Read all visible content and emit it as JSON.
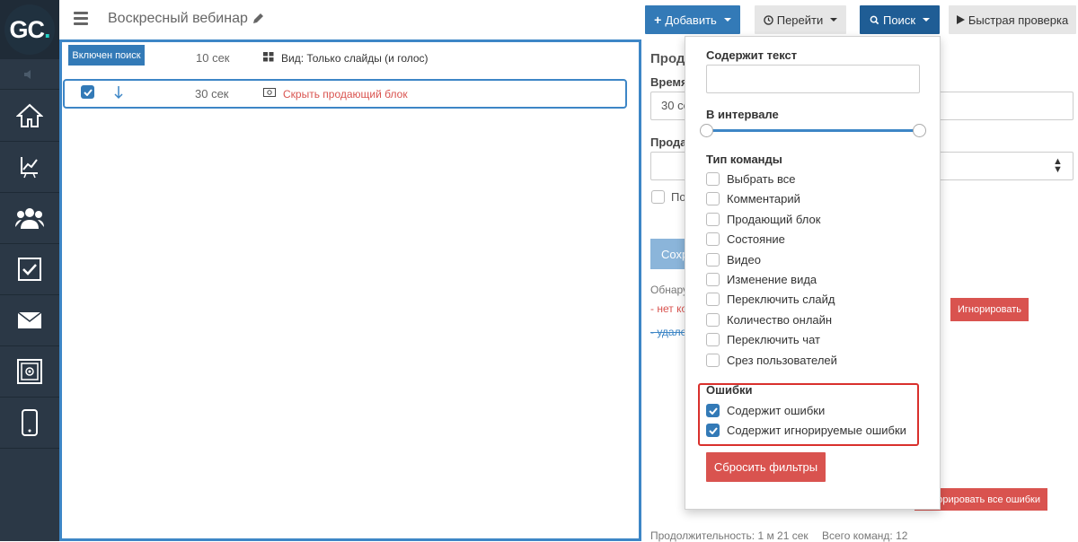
{
  "logo": {
    "text": "GC",
    "dot": "."
  },
  "header": {
    "title": "Воскресный вебинар",
    "add_label": "Добавить",
    "goto_label": "Перейти",
    "search_label": "Поиск",
    "quick_check_label": "Быстрая проверка"
  },
  "list": {
    "search_badge": "Включен поиск",
    "rows": [
      {
        "time": "10 сек",
        "text": "Вид: Только слайды (и голос)"
      },
      {
        "time": "30 сек",
        "text": "Скрыть продающий блок"
      }
    ]
  },
  "right_panel": {
    "heading_partial": "Прод",
    "time_label_partial": "Время",
    "time_value_partial": "30 се",
    "seller_label_partial": "Прода",
    "checkbox_label_partial": "По",
    "save_partial": "Сохр",
    "found_partial": "Обнару",
    "err1_partial": "- нет ко",
    "err2_partial": "- удале",
    "ignore_label": "Игнорировать",
    "ignore_all_label": "орировать все ошибки",
    "duration_text": "Продолжительность: 1 м 21 сек",
    "total_text": "Всего команд: 12"
  },
  "filters": {
    "contains_text_label": "Содержит текст",
    "interval_label": "В интервале",
    "command_type_label": "Тип команды",
    "types": [
      {
        "label": "Выбрать все",
        "checked": false
      },
      {
        "label": "Комментарий",
        "checked": false
      },
      {
        "label": "Продающий блок",
        "checked": false
      },
      {
        "label": "Состояние",
        "checked": false
      },
      {
        "label": "Видео",
        "checked": false
      },
      {
        "label": "Изменение вида",
        "checked": false
      },
      {
        "label": "Переключить слайд",
        "checked": false
      },
      {
        "label": "Количество онлайн",
        "checked": false
      },
      {
        "label": "Переключить чат",
        "checked": false
      },
      {
        "label": "Срез пользователей",
        "checked": false
      }
    ],
    "errors_label": "Ошибки",
    "errors": [
      {
        "label": "Содержит ошибки",
        "checked": true
      },
      {
        "label": "Содержит игнорируемые ошибки",
        "checked": true
      }
    ],
    "reset_label": "Сбросить фильтры"
  },
  "colors": {
    "primary": "#337ab7",
    "danger": "#d9534f",
    "sidebar": "#2b3846",
    "accent": "#23d3c6"
  }
}
